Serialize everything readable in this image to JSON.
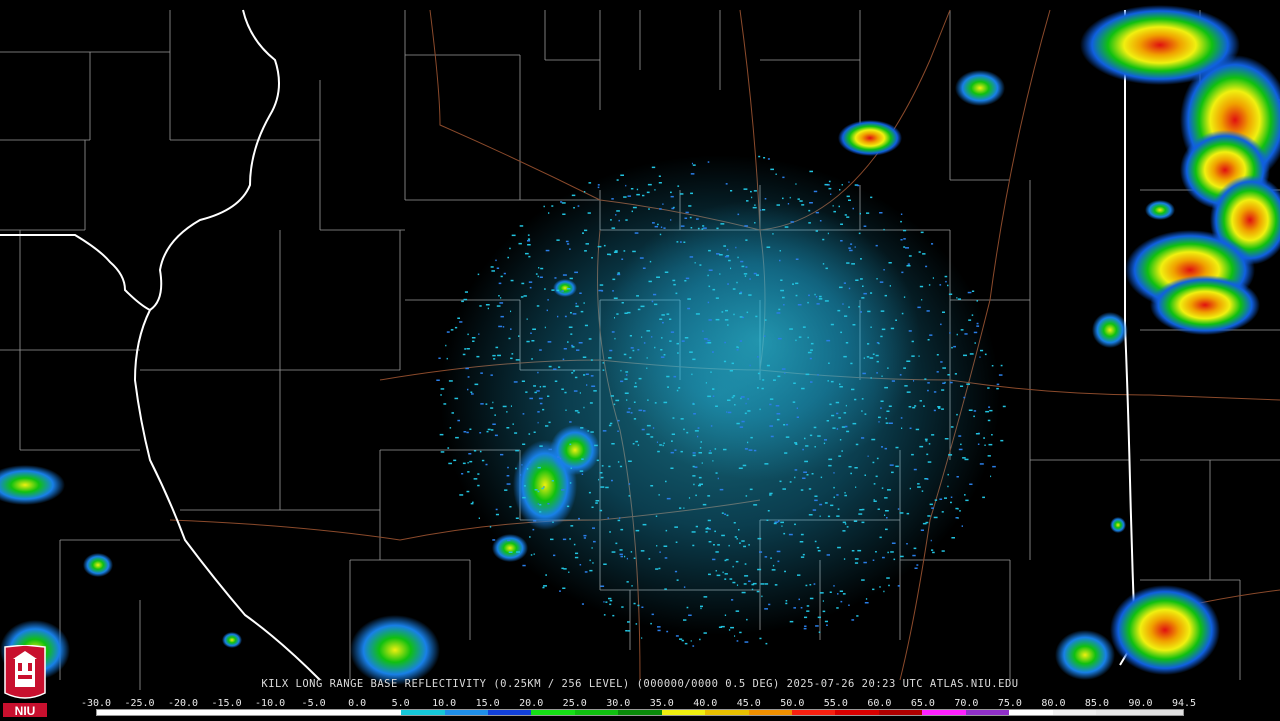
{
  "product": {
    "caption": "KILX LONG RANGE BASE REFLECTIVITY (0.25KM / 256 LEVEL) (000000/0000 0.5 DEG) 2025-07-26 20:23 UTC  ATLAS.NIU.EDU"
  },
  "logo": {
    "text": "NIU",
    "description": "niu-seal-logo"
  },
  "legend": {
    "ticks": [
      "-30.0",
      "-25.0",
      "-20.0",
      "-15.0",
      "-10.0",
      "-5.0",
      "0.0",
      "5.0",
      "10.0",
      "15.0",
      "20.0",
      "25.0",
      "30.0",
      "35.0",
      "40.0",
      "45.0",
      "50.0",
      "55.0",
      "60.0",
      "65.0",
      "70.0",
      "75.0",
      "80.0",
      "85.0",
      "90.0",
      "94.5"
    ],
    "colors": [
      "#ffffff",
      "#ffffff",
      "#ffffff",
      "#ffffff",
      "#ffffff",
      "#ffffff",
      "#ffffff",
      "#15c8d8",
      "#1f8fe8",
      "#1240d8",
      "#16e016",
      "#10c010",
      "#0a8a0a",
      "#f0f010",
      "#e8c000",
      "#f09000",
      "#f82010",
      "#d80000",
      "#b00000",
      "#ff20ff",
      "#9030c8",
      "#ffffff",
      "#f0f0f0",
      "#e8e8e8",
      "#e0e0e0"
    ]
  },
  "colors": {
    "background": "#000000",
    "county_lines": "#9a9a9a",
    "state_lines": "#ffffff",
    "roads": "#8b4a2b"
  }
}
